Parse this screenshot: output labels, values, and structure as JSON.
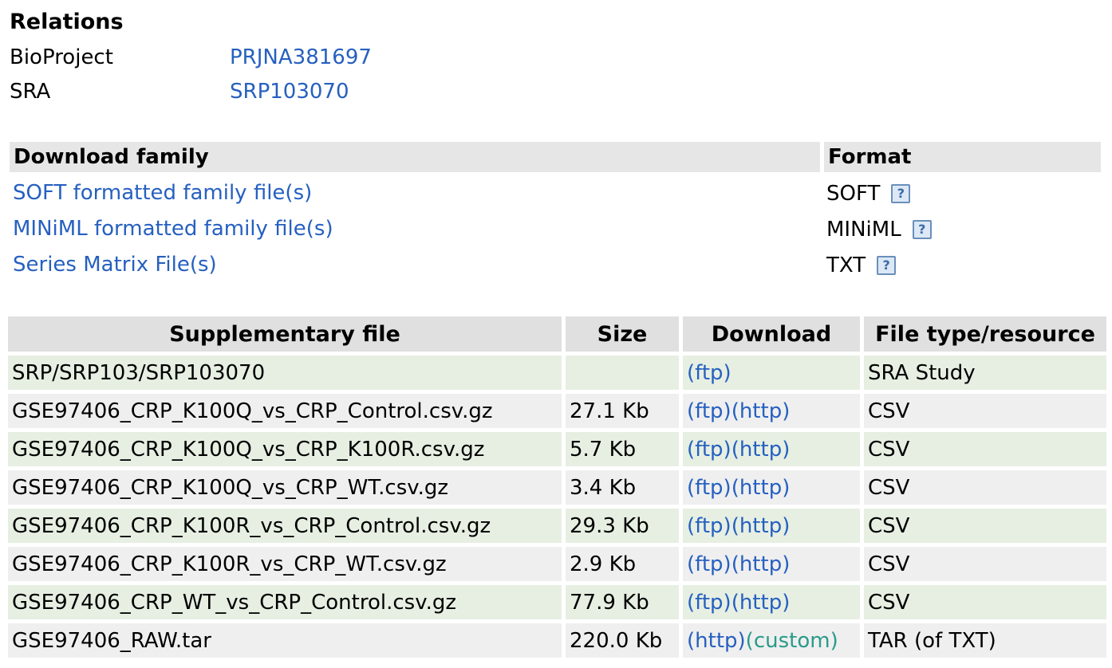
{
  "relations": {
    "title": "Relations",
    "rows": [
      {
        "label": "BioProject",
        "value": "PRJNA381697"
      },
      {
        "label": "SRA",
        "value": "SRP103070"
      }
    ]
  },
  "download_family": {
    "header_family": "Download family",
    "header_format": "Format",
    "rows": [
      {
        "link": "SOFT formatted family file(s)",
        "format": "SOFT"
      },
      {
        "link": "MINiML formatted family file(s)",
        "format": "MINiML"
      },
      {
        "link": "Series Matrix File(s)",
        "format": "TXT"
      }
    ],
    "help_glyph": "?"
  },
  "supplementary": {
    "headers": {
      "file": "Supplementary file",
      "size": "Size",
      "download": "Download",
      "type": "File type/resource"
    },
    "rows": [
      {
        "file": "SRP/SRP103/SRP103070",
        "size": "",
        "links": [
          "(ftp)"
        ],
        "type": "SRA Study"
      },
      {
        "file": "GSE97406_CRP_K100Q_vs_CRP_Control.csv.gz",
        "size": "27.1 Kb",
        "links": [
          "(ftp)",
          "(http)"
        ],
        "type": "CSV"
      },
      {
        "file": "GSE97406_CRP_K100Q_vs_CRP_K100R.csv.gz",
        "size": "5.7 Kb",
        "links": [
          "(ftp)",
          "(http)"
        ],
        "type": "CSV"
      },
      {
        "file": "GSE97406_CRP_K100Q_vs_CRP_WT.csv.gz",
        "size": "3.4 Kb",
        "links": [
          "(ftp)",
          "(http)"
        ],
        "type": "CSV"
      },
      {
        "file": "GSE97406_CRP_K100R_vs_CRP_Control.csv.gz",
        "size": "29.3 Kb",
        "links": [
          "(ftp)",
          "(http)"
        ],
        "type": "CSV"
      },
      {
        "file": "GSE97406_CRP_K100R_vs_CRP_WT.csv.gz",
        "size": "2.9 Kb",
        "links": [
          "(ftp)",
          "(http)"
        ],
        "type": "CSV"
      },
      {
        "file": "GSE97406_CRP_WT_vs_CRP_Control.csv.gz",
        "size": "77.9 Kb",
        "links": [
          "(ftp)",
          "(http)"
        ],
        "type": "CSV"
      },
      {
        "file": "GSE97406_RAW.tar",
        "size": "220.0 Kb",
        "links": [
          "(http)",
          "(custom)"
        ],
        "type": "TAR (of TXT)"
      }
    ]
  },
  "colors": {
    "link": "#2660c0",
    "custom_link": "#2a9a8a",
    "row_green": "#e6efe2",
    "row_gray": "#efefef",
    "header_gray": "#e0e0e0"
  }
}
